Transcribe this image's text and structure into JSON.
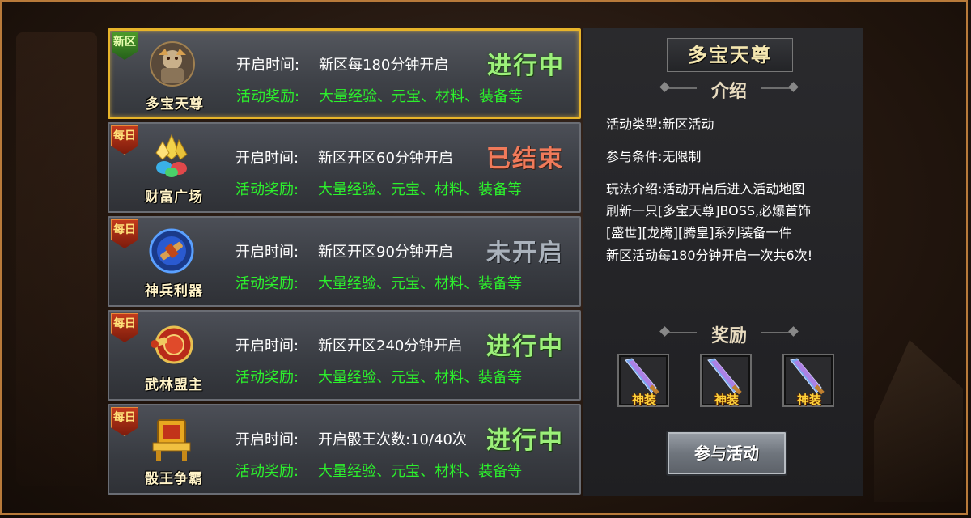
{
  "activities": [
    {
      "badge": "新区",
      "badge_type": "new",
      "icon": "duobao-tianzun-icon",
      "name": "多宝天尊",
      "open_label": "开启时间:",
      "open_value": "新区每180分钟开启",
      "reward_label": "活动奖励:",
      "reward_value": "大量经验、元宝、材料、装备等",
      "status": "进行中",
      "status_color": "green",
      "selected": true
    },
    {
      "badge": "每日",
      "badge_type": "daily",
      "icon": "caifu-guangchang-icon",
      "name": "财富广场",
      "open_label": "开启时间:",
      "open_value": "新区开区60分钟开启",
      "reward_label": "活动奖励:",
      "reward_value": "大量经验、元宝、材料、装备等",
      "status": "已结束",
      "status_color": "red",
      "selected": false
    },
    {
      "badge": "每日",
      "badge_type": "daily",
      "icon": "shenbing-liqi-icon",
      "name": "神兵利器",
      "open_label": "开启时间:",
      "open_value": "新区开区90分钟开启",
      "reward_label": "活动奖励:",
      "reward_value": "大量经验、元宝、材料、装备等",
      "status": "未开启",
      "status_color": "gray",
      "selected": false
    },
    {
      "badge": "每日",
      "badge_type": "daily",
      "icon": "wulin-mengzhu-icon",
      "name": "武林盟主",
      "open_label": "开启时间:",
      "open_value": "新区开区240分钟开启",
      "reward_label": "活动奖励:",
      "reward_value": "大量经验、元宝、材料、装备等",
      "status": "进行中",
      "status_color": "green",
      "selected": false
    },
    {
      "badge": "每日",
      "badge_type": "daily",
      "icon": "touwang-zhengba-icon",
      "name": "骰王争霸",
      "open_label": "开启时间:",
      "open_value": "开启骰王次数:10/40次",
      "reward_label": "活动奖励:",
      "reward_value": "大量经验、元宝、材料、装备等",
      "status": "进行中",
      "status_color": "green",
      "selected": false
    }
  ],
  "detail": {
    "title": "多宝天尊",
    "intro_header": "介绍",
    "type_line": "活动类型:新区活动",
    "condition_line": "参与条件:无限制",
    "gameplay_lines": [
      "玩法介绍:活动开启后进入活动地图",
      "刷新一只[多宝天尊]BOSS,必爆首饰",
      "[盛世][龙腾][腾皇]系列装备一件",
      "新区活动每180分钟开启一次共6次!"
    ],
    "reward_header": "奖励",
    "reward_items": [
      {
        "tag": "神装",
        "icon": "divine-sword-icon"
      },
      {
        "tag": "神装",
        "icon": "divine-sword-icon"
      },
      {
        "tag": "神装",
        "icon": "divine-sword-icon"
      }
    ],
    "join_button": "参与活动"
  },
  "colors": {
    "selected_border": "#e7b42a",
    "reward_text": "#2cf02c",
    "status_green": "#9cf07a",
    "status_red": "#f07a5a",
    "status_gray": "#aab2bc"
  }
}
